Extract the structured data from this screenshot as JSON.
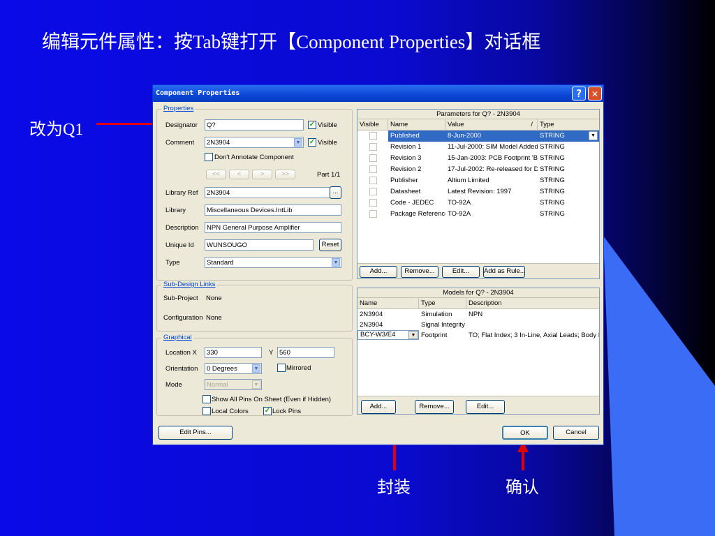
{
  "slide": {
    "title": "编辑元件属性：按Tab键打开【Component Properties】对话框",
    "note_designator": "改为Q1",
    "note_footprint": "封装",
    "note_ok": "确认"
  },
  "dialog": {
    "title": "Component Properties",
    "help": "?",
    "close": "✕",
    "properties": {
      "group": "Properties",
      "designator_label": "Designator",
      "designator_value": "Q?",
      "designator_visible": "Visible",
      "comment_label": "Comment",
      "comment_value": "2N3904",
      "comment_visible": "Visible",
      "dont_annotate": "Don't Annotate Component",
      "nav": [
        "<<",
        "<",
        ">",
        ">>"
      ],
      "part": "Part 1/1",
      "libref_label": "Library Ref",
      "libref_value": "2N3904",
      "browse": "...",
      "library_label": "Library",
      "library_value": "Miscellaneous Devices.IntLib",
      "description_label": "Description",
      "description_value": "NPN General Purpose Amplifier",
      "uniqueid_label": "Unique Id",
      "uniqueid_value": "WUNSOUGO",
      "reset": "Reset",
      "type_label": "Type",
      "type_value": "Standard"
    },
    "subdesign": {
      "group": "Sub-Design Links",
      "subproject_label": "Sub-Project",
      "subproject_value": "None",
      "config_label": "Configuration",
      "config_value": "None"
    },
    "graphical": {
      "group": "Graphical",
      "location_label": "Location  X",
      "x_value": "330",
      "y_label": "Y",
      "y_value": "560",
      "orientation_label": "Orientation",
      "orientation_value": "0 Degrees",
      "mirrored": "Mirrored",
      "mode_label": "Mode",
      "mode_value": "Normal",
      "show_pins": "Show All Pins On Sheet (Even if Hidden)",
      "local_colors": "Local Colors",
      "lock_pins": "Lock Pins"
    },
    "parameters": {
      "header": "Parameters for Q? - 2N3904",
      "columns": [
        "Visible",
        "Name",
        "Value",
        "Type"
      ],
      "sort_marker": "/",
      "rows": [
        {
          "name": "Published",
          "value": "8-Jun-2000",
          "type": "STRING"
        },
        {
          "name": "Revision 1",
          "value": "11-Jul-2000: SIM Model Added",
          "type": "STRING"
        },
        {
          "name": "Revision 3",
          "value": "15-Jan-2003: PCB Footprint 'BC",
          "type": "STRING"
        },
        {
          "name": "Revision 2",
          "value": "17-Jul-2002: Re-released for DX",
          "type": "STRING"
        },
        {
          "name": "Publisher",
          "value": "Altium Limited",
          "type": "STRING"
        },
        {
          "name": "Datasheet",
          "value": "Latest Revision: 1997",
          "type": "STRING"
        },
        {
          "name": "Code - JEDEC",
          "value": "TO-92A",
          "type": "STRING"
        },
        {
          "name": "Package Reference",
          "value": "TO-92A",
          "type": "STRING"
        }
      ],
      "buttons": [
        "Add...",
        "Remove...",
        "Edit...",
        "Add as Rule..."
      ]
    },
    "models": {
      "header": "Models for Q? - 2N3904",
      "columns": [
        "Name",
        "Type",
        "Description"
      ],
      "rows": [
        {
          "name": "2N3904",
          "type": "Simulation",
          "desc": "NPN"
        },
        {
          "name": "2N3904",
          "type": "Signal Integrity",
          "desc": ""
        },
        {
          "name": "BCY-W3/E4",
          "type": "Footprint",
          "desc": "TO; Flat Index; 3 In-Line, Axial Leads; Body Dia"
        }
      ],
      "buttons": [
        "Add...",
        "Remove...",
        "Edit..."
      ]
    },
    "footer": {
      "edit_pins": "Edit Pins...",
      "ok": "OK",
      "cancel": "Cancel"
    }
  }
}
